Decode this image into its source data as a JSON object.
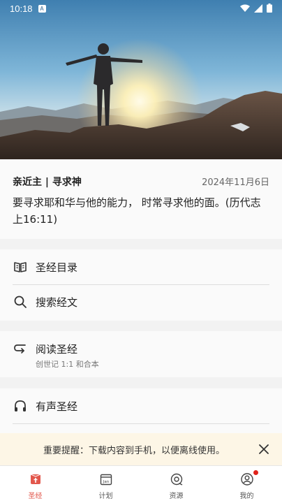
{
  "status_bar": {
    "time": "10:18",
    "badge": "A"
  },
  "hero": {
    "image": "person-arms-raised-sunset-mountains"
  },
  "verse": {
    "title": "亲近主 | 寻求神",
    "date": "2024年11月6日",
    "text": "要寻求耶和华与他的能力， 时常寻求他的面。(历代志上16:11)"
  },
  "menu": {
    "catalog": "圣经目录",
    "search": "搜索经文",
    "read": "阅读圣经",
    "read_sub": "创世记 1:1 和合本",
    "audio": "有声圣经"
  },
  "notice": {
    "text": "重要提醒：下载内容到手机，以便离线使用。"
  },
  "tabs": [
    {
      "label": "圣经",
      "icon": "bible-icon",
      "active": true
    },
    {
      "label": "计划",
      "icon": "calendar-icon",
      "active": false
    },
    {
      "label": "资源",
      "icon": "disc-icon",
      "active": false
    },
    {
      "label": "我的",
      "icon": "user-icon",
      "active": false,
      "badge": true
    }
  ],
  "colors": {
    "accent": "#e2574c",
    "notice_bg": "#fdf6e6",
    "badge": "#e0231b"
  }
}
